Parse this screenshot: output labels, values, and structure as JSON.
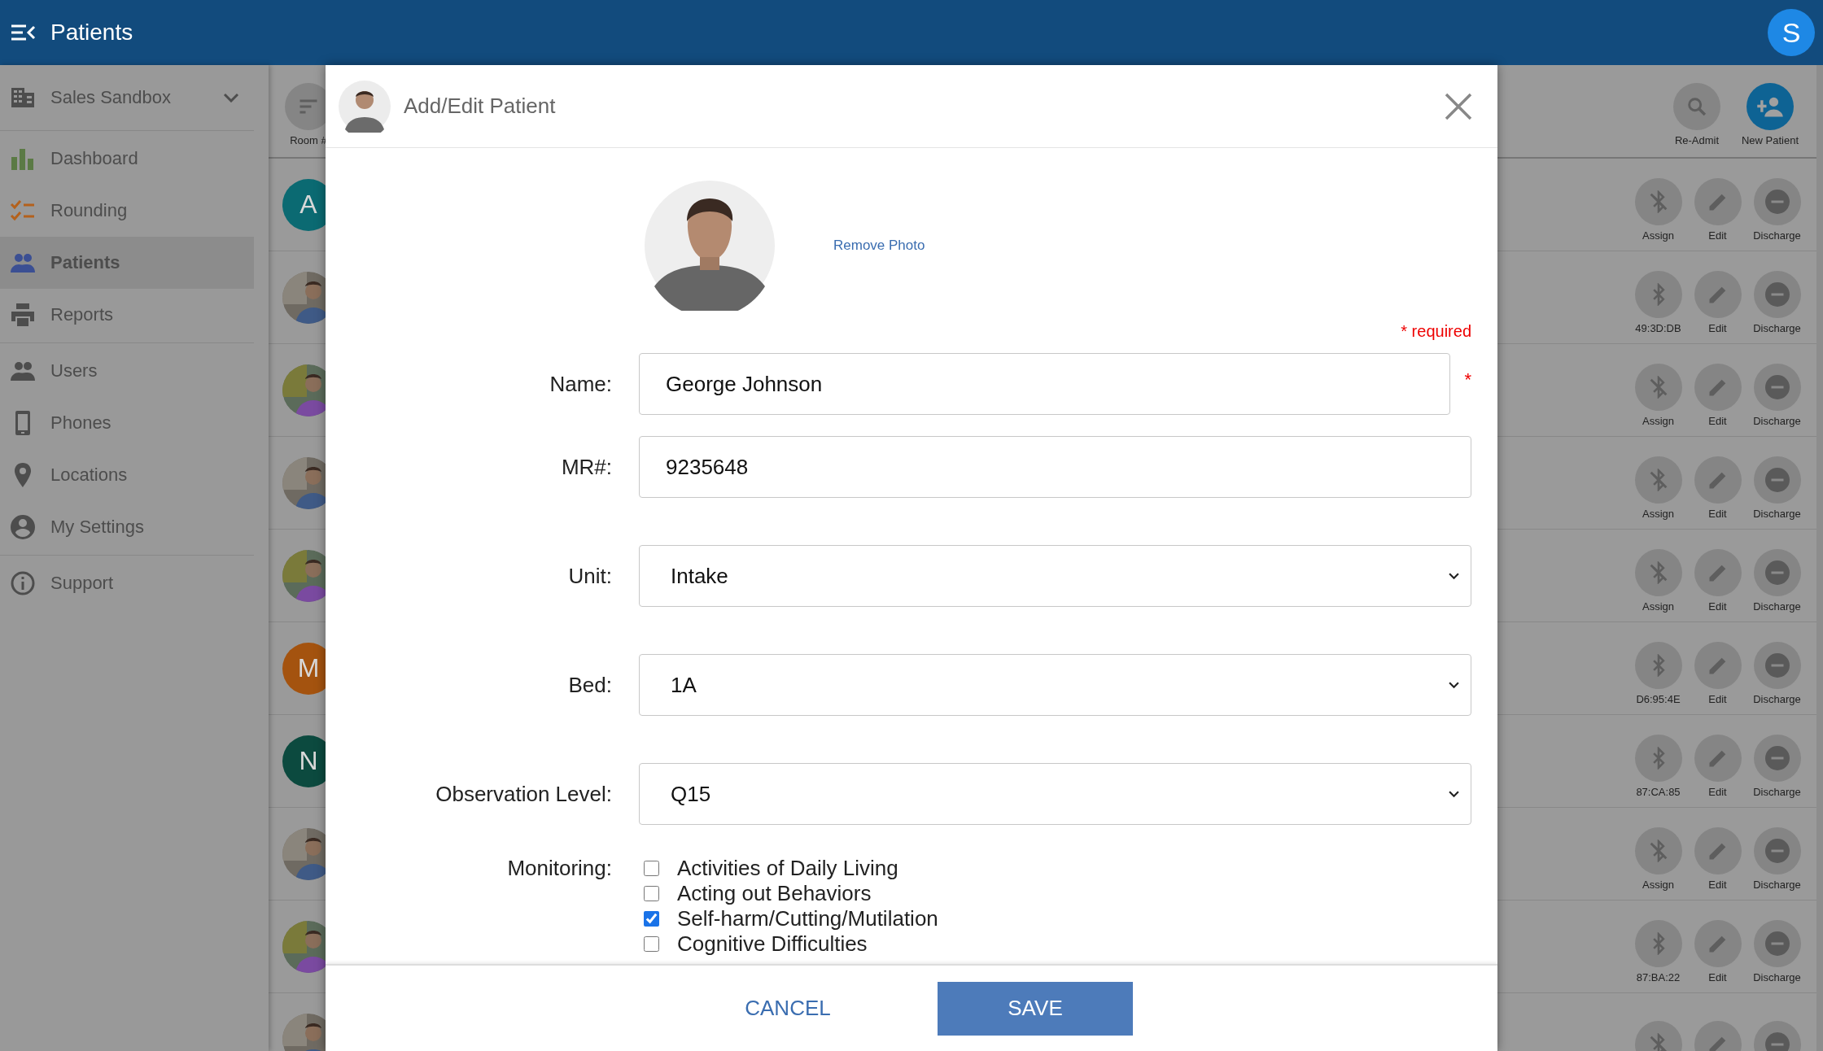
{
  "app_bar": {
    "title": "Patients",
    "user_initial": "S"
  },
  "sidebar": {
    "org": "Sales Sandbox",
    "groups": [
      [
        {
          "label": "Dashboard",
          "kind": "chart",
          "color": "#5b7a45",
          "selected": false
        },
        {
          "label": "Rounding",
          "kind": "checklist",
          "color": "#b4611c",
          "selected": false
        },
        {
          "label": "Patients",
          "kind": "people",
          "color": "#3b4f93",
          "selected": true
        },
        {
          "label": "Reports",
          "kind": "printer",
          "color": "#4d4d4d",
          "selected": false
        }
      ],
      [
        {
          "label": "Users",
          "kind": "people",
          "color": "#4d4d4d",
          "selected": false
        },
        {
          "label": "Phones",
          "kind": "phone",
          "color": "#4d4d4d",
          "selected": false
        },
        {
          "label": "Locations",
          "kind": "pin",
          "color": "#4d4d4d",
          "selected": false
        },
        {
          "label": "My Settings",
          "kind": "account",
          "color": "#4d4d4d",
          "selected": false
        }
      ],
      [
        {
          "label": "Support",
          "kind": "info",
          "color": "#4d4d4d",
          "selected": false
        }
      ]
    ]
  },
  "toolbar": {
    "sort": {
      "label": "Room #"
    },
    "actions": [
      {
        "label": "Re-Admit",
        "kind": "search",
        "primary": false
      },
      {
        "label": "New Patient",
        "kind": "add_person",
        "primary": true
      }
    ]
  },
  "rows": [
    {
      "avatar": {
        "kind": "letter",
        "letter": "A",
        "color": "#0b6a72"
      },
      "device": {
        "label": "Assign",
        "paired": false
      },
      "edit": "Edit",
      "discharge": "Discharge"
    },
    {
      "device": {
        "label": "49:3D:DB",
        "paired": true
      },
      "edit": "Edit",
      "discharge": "Discharge"
    },
    {
      "device": {
        "label": "Assign",
        "paired": false
      },
      "edit": "Edit",
      "discharge": "Discharge"
    },
    {
      "device": {
        "label": "Assign",
        "paired": false
      },
      "edit": "Edit",
      "discharge": "Discharge"
    },
    {
      "device": {
        "label": "Assign",
        "paired": false
      },
      "edit": "Edit",
      "discharge": "Discharge"
    },
    {
      "avatar": {
        "kind": "letter",
        "letter": "M",
        "color": "#a4530f"
      },
      "device": {
        "label": "D6:95:4E",
        "paired": true
      },
      "edit": "Edit",
      "discharge": "Discharge"
    },
    {
      "avatar": {
        "kind": "letter",
        "letter": "N",
        "color": "#0c4a3f"
      },
      "device": {
        "label": "87:CA:85",
        "paired": true
      },
      "edit": "Edit",
      "discharge": "Discharge"
    },
    {
      "device": {
        "label": "Assign",
        "paired": false
      },
      "edit": "Edit",
      "discharge": "Discharge"
    },
    {
      "device": {
        "label": "87:BA:22",
        "paired": true
      },
      "edit": "Edit",
      "discharge": "Discharge"
    },
    {
      "device": {
        "paired": false
      }
    }
  ],
  "dialog": {
    "title": "Add/Edit Patient",
    "remove_photo": "Remove Photo",
    "required_note": "* required",
    "fields": [
      {
        "label": "Name:",
        "kind": "text",
        "value": "George Johnson",
        "required_mark": "*"
      },
      {
        "label": "MR#:",
        "kind": "text",
        "value": "9235648"
      },
      {
        "label": "Unit:",
        "kind": "select",
        "value": "Intake"
      },
      {
        "label": "Bed:",
        "kind": "select",
        "value": "1A"
      },
      {
        "label": "Observation Level:",
        "kind": "select",
        "value": "Q15"
      }
    ],
    "monitoring": {
      "label": "Monitoring:",
      "options": [
        {
          "label": "Activities of Daily Living",
          "checked": false
        },
        {
          "label": "Acting out Behaviors",
          "checked": false
        },
        {
          "label": "Self-harm/Cutting/Mutilation",
          "checked": true
        },
        {
          "label": "Cognitive Difficulties",
          "checked": false
        }
      ]
    },
    "cancel": "CANCEL",
    "save": "SAVE"
  }
}
